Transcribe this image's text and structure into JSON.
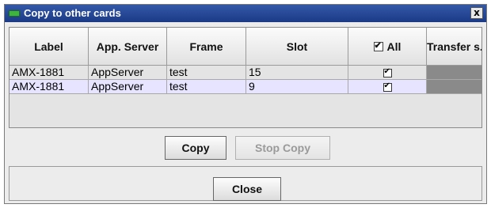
{
  "window": {
    "title": "Copy to other cards",
    "close_label": "x"
  },
  "table": {
    "columns": [
      "Label",
      "App. Server",
      "Frame",
      "Slot",
      "All",
      "Transfer s..."
    ],
    "all_checked": true,
    "rows": [
      {
        "label": "AMX-1881",
        "app_server": "AppServer",
        "frame": "test",
        "slot": "15",
        "checked": true,
        "transfer": ""
      },
      {
        "label": "AMX-1881",
        "app_server": "AppServer",
        "frame": "test",
        "slot": "9",
        "checked": true,
        "transfer": ""
      }
    ]
  },
  "buttons": {
    "copy": "Copy",
    "stop_copy": "Stop Copy",
    "close": "Close"
  },
  "colors": {
    "title_bar": "#2a4c9c",
    "selected_row": "#e6e4ff",
    "transfer_cell": "#8a8a8a"
  }
}
